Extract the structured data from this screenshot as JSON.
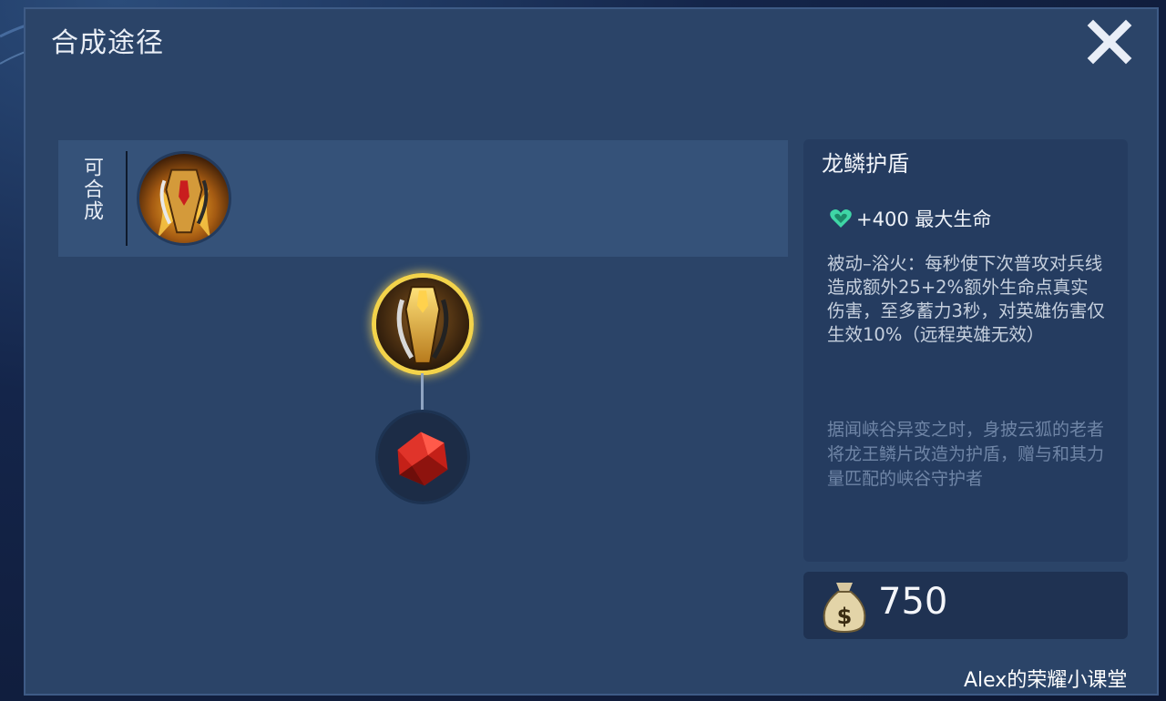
{
  "header": {
    "title": "合成途径",
    "close_icon": "close-icon"
  },
  "craft_row": {
    "label": "可合成",
    "items": [
      {
        "icon": "golden-flame-shield-icon"
      }
    ]
  },
  "recipe_tree": {
    "root": {
      "icon": "dragon-scale-shield-icon",
      "selected": true
    },
    "components": [
      {
        "icon": "red-gem-icon"
      }
    ]
  },
  "item_info": {
    "name": "龙鳞护盾",
    "stat_icon": "heart-icon",
    "stat": "+400 最大生命",
    "passive": "被动–浴火：每秒使下次普攻对兵线造成额外25+2%额外生命点真实伤害，至多蓄力3秒，对英雄伤害仅生效10%（远程英雄无效）",
    "lore": "据闻峡谷异变之时，身披云狐的老者将龙王鳞片改造为护盾，赠与和其力量匹配的峡谷守护者"
  },
  "price": {
    "icon": "money-bag-icon",
    "value": "750"
  },
  "watermark": "Alex的荣耀小课堂",
  "colors": {
    "panel": "#2b4468",
    "highlight_ring": "#f3d34a",
    "stat_heart": "#3fd6a6"
  }
}
